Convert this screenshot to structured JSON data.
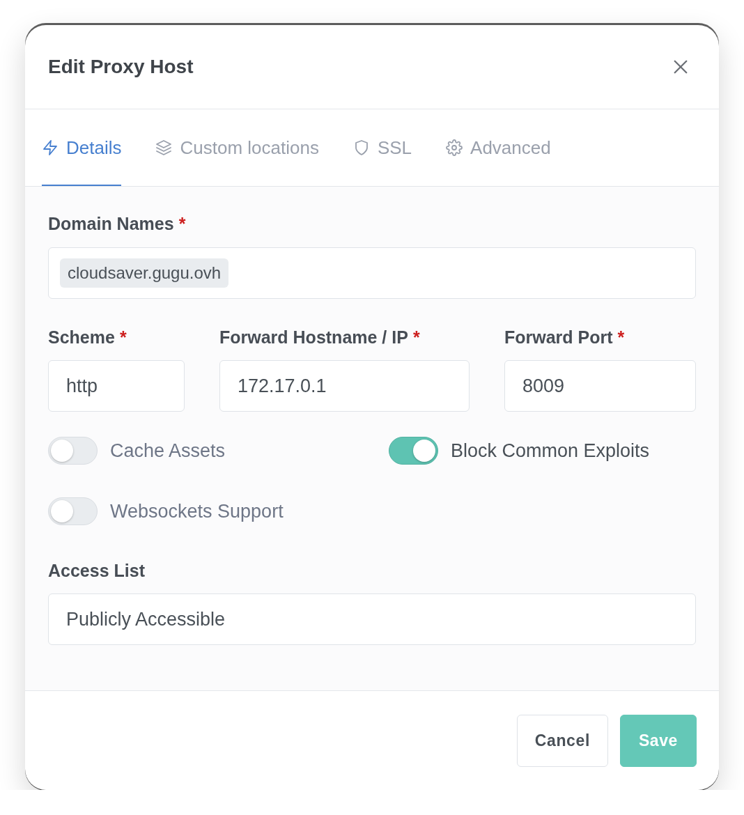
{
  "dialog": {
    "title": "Edit Proxy Host"
  },
  "tabs": [
    {
      "label": "Details",
      "selected": true
    },
    {
      "label": "Custom locations",
      "selected": false
    },
    {
      "label": "SSL",
      "selected": false
    },
    {
      "label": "Advanced",
      "selected": false
    }
  ],
  "form": {
    "domain_names": {
      "label": "Domain Names",
      "required_mark": "*",
      "tags": [
        "cloudsaver.gugu.ovh"
      ]
    },
    "forward": [
      {
        "label": "Scheme",
        "required_mark": "*",
        "value": "http"
      },
      {
        "label": "Forward Hostname / IP",
        "required_mark": "*",
        "value": "172.17.0.1"
      },
      {
        "label": "Forward Port",
        "required_mark": "*",
        "value": "8009"
      }
    ],
    "toggles": [
      {
        "label": "Cache Assets",
        "on": false
      },
      {
        "label": "Block Common Exploits",
        "on": true
      },
      {
        "label": "Websockets Support",
        "on": false
      }
    ],
    "access_list": {
      "label": "Access List",
      "value": "Publicly Accessible"
    }
  },
  "footer": {
    "buttons": [
      {
        "label": "Cancel",
        "kind": "secondary"
      },
      {
        "label": "Save",
        "kind": "primary"
      }
    ]
  }
}
